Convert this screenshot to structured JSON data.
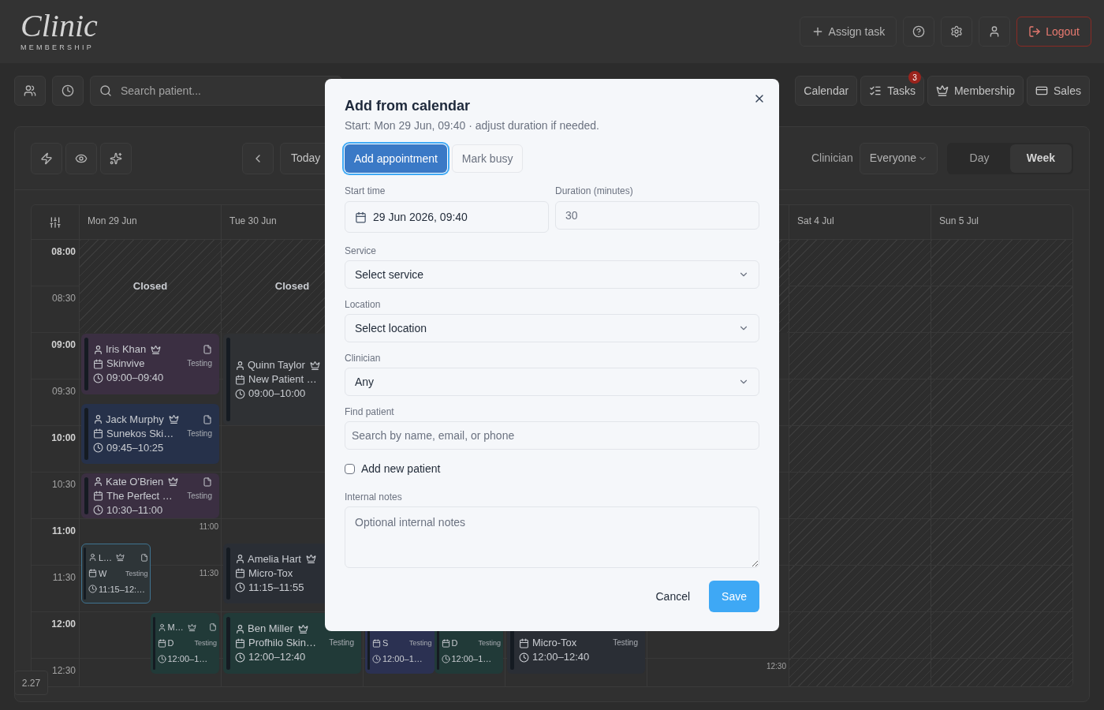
{
  "header": {
    "logo_script": "Clinic",
    "logo_caption": "MEMBERSHIP",
    "actions": [
      {
        "kind": "assign",
        "label": "Assign task"
      },
      {
        "kind": "help"
      },
      {
        "kind": "settings"
      },
      {
        "kind": "account"
      },
      {
        "kind": "logout",
        "label": "Logout"
      }
    ]
  },
  "nav": {
    "tools": [
      {
        "kind": "patients"
      },
      {
        "kind": "history"
      }
    ],
    "search": {
      "placeholder": "Search patient..."
    },
    "links": [
      {
        "kind": "calendar",
        "label": "Calendar"
      },
      {
        "kind": "tasks",
        "label": "Tasks",
        "badge": "3"
      },
      {
        "kind": "membership",
        "label": "Membership"
      },
      {
        "kind": "sales",
        "label": "Sales"
      }
    ]
  },
  "toolbar": {
    "tools": [
      {
        "kind": "quick"
      },
      {
        "kind": "visibility"
      },
      {
        "kind": "magic"
      }
    ],
    "today": "Today",
    "clinician_label": "Clinician",
    "clinician_value": "Everyone",
    "views": [
      {
        "label": "Day",
        "selected": false
      },
      {
        "label": "Week",
        "selected": true
      }
    ]
  },
  "calendar": {
    "times": [
      {
        "label": "08:00",
        "kind": "hour"
      },
      {
        "label": "08:30",
        "kind": "half"
      },
      {
        "label": "09:00",
        "kind": "hour"
      },
      {
        "label": "09:30",
        "kind": "half"
      },
      {
        "label": "10:00",
        "kind": "hour"
      },
      {
        "label": "10:30",
        "kind": "half"
      },
      {
        "label": "11:00",
        "kind": "hour"
      },
      {
        "label": "11:30",
        "kind": "half"
      },
      {
        "label": "12:00",
        "kind": "hour"
      },
      {
        "label": "12:30",
        "kind": "half"
      }
    ],
    "days": [
      {
        "label": "Mon 29 Jun",
        "kind": "closed_morning",
        "closed_label": "Closed",
        "slot_labels": [
          "11:00",
          "11:30"
        ],
        "events": [
          {
            "kind": "full",
            "patient": "Iris Khan",
            "member": true,
            "note": true,
            "service": "Skinvive",
            "tag": "Testing",
            "time": "09:00–09:40",
            "color": "#3b2f42",
            "selected": false
          },
          {
            "kind": "full",
            "patient": "Jack Murphy",
            "member": true,
            "note": true,
            "service": "Sunekos Ski…",
            "tag": "Testing",
            "time": "09:45–10:25",
            "color": "#26314a",
            "selected": false
          },
          {
            "kind": "full",
            "patient": "Kate O'Brien",
            "member": true,
            "note": true,
            "service": "The Perfect …",
            "tag": "Testing",
            "time": "10:30–11:00",
            "color": "#3b2f42",
            "selected": false
          },
          {
            "kind": "left",
            "patient": "L…",
            "member": true,
            "note": true,
            "service": "W",
            "tag": "Testing",
            "time": "11:15–12:…",
            "color": "#2e3538",
            "selected": true
          },
          {
            "kind": "right",
            "patient": "M…",
            "member": true,
            "note": true,
            "service": "D",
            "tag": "Testing",
            "time": "12:00–1…",
            "color": "#213a38",
            "selected": false
          }
        ]
      },
      {
        "label": "Tue 30 Jun",
        "kind": "closed_morning",
        "closed_label": "Closed",
        "events": [
          {
            "kind": "full",
            "patient": "Quinn Taylor",
            "member": true,
            "note": false,
            "service": "New Patient …",
            "time": "09:00–10:00",
            "color": "#2f3134",
            "selected": false
          },
          {
            "kind": "full",
            "patient": "Amelia Hart",
            "member": true,
            "note": false,
            "service": "Micro-Tox",
            "time": "11:15–11:55",
            "color": "#2a2e35",
            "selected": false
          },
          {
            "kind": "full",
            "patient": "Ben Miller",
            "member": true,
            "note": false,
            "service": "Profhilo Skin…",
            "tag": "Testing",
            "time": "12:00–12:40",
            "color": "#213a38",
            "selected": false
          }
        ]
      },
      {
        "kind": "open",
        "events": [
          {
            "kind": "left",
            "service": "S",
            "tag": "Testing",
            "time": "12:00–1…",
            "color": "#2b3152",
            "selected": false
          },
          {
            "kind": "right",
            "service": "D",
            "tag": "Testing",
            "time": "12:00–1…",
            "color": "#213a38",
            "selected": false
          }
        ]
      },
      {
        "kind": "open",
        "events": [
          {
            "kind": "full",
            "service": "Micro-Tox",
            "tag": "Testing",
            "time": "12:00–12:40",
            "color": "#2a2e35",
            "selected": false
          }
        ]
      },
      {
        "kind": "closed_morning",
        "slot_labels": [
          "12:30"
        ]
      },
      {
        "label": "Sat 4 Jul",
        "kind": "closed_all_day"
      },
      {
        "label": "Sun 5 Jul",
        "kind": "closed_all_day"
      }
    ],
    "zoom_badge": "2.27"
  },
  "modal": {
    "title": "Add from calendar",
    "subtitle": "Start: Mon 29 Jun, 09:40 · adjust duration if needed.",
    "tabs": [
      {
        "label": "Add appointment",
        "selected": true
      },
      {
        "label": "Mark busy",
        "selected": false
      }
    ],
    "start_label": "Start time",
    "start_value": "29 Jun 2026, 09:40",
    "duration_label": "Duration (minutes)",
    "duration_value": "30",
    "selects": [
      {
        "label": "Service",
        "value": "Select service"
      },
      {
        "label": "Location",
        "value": "Select location"
      },
      {
        "label": "Clinician",
        "value": "Any"
      }
    ],
    "patient_label": "Find patient",
    "patient_placeholder": "Search by name, email, or phone",
    "new_patient": {
      "label": "Add new patient",
      "checked": false
    },
    "notes_label": "Internal notes",
    "notes_placeholder": "Optional internal notes",
    "cancel": "Cancel",
    "save": "Save"
  }
}
